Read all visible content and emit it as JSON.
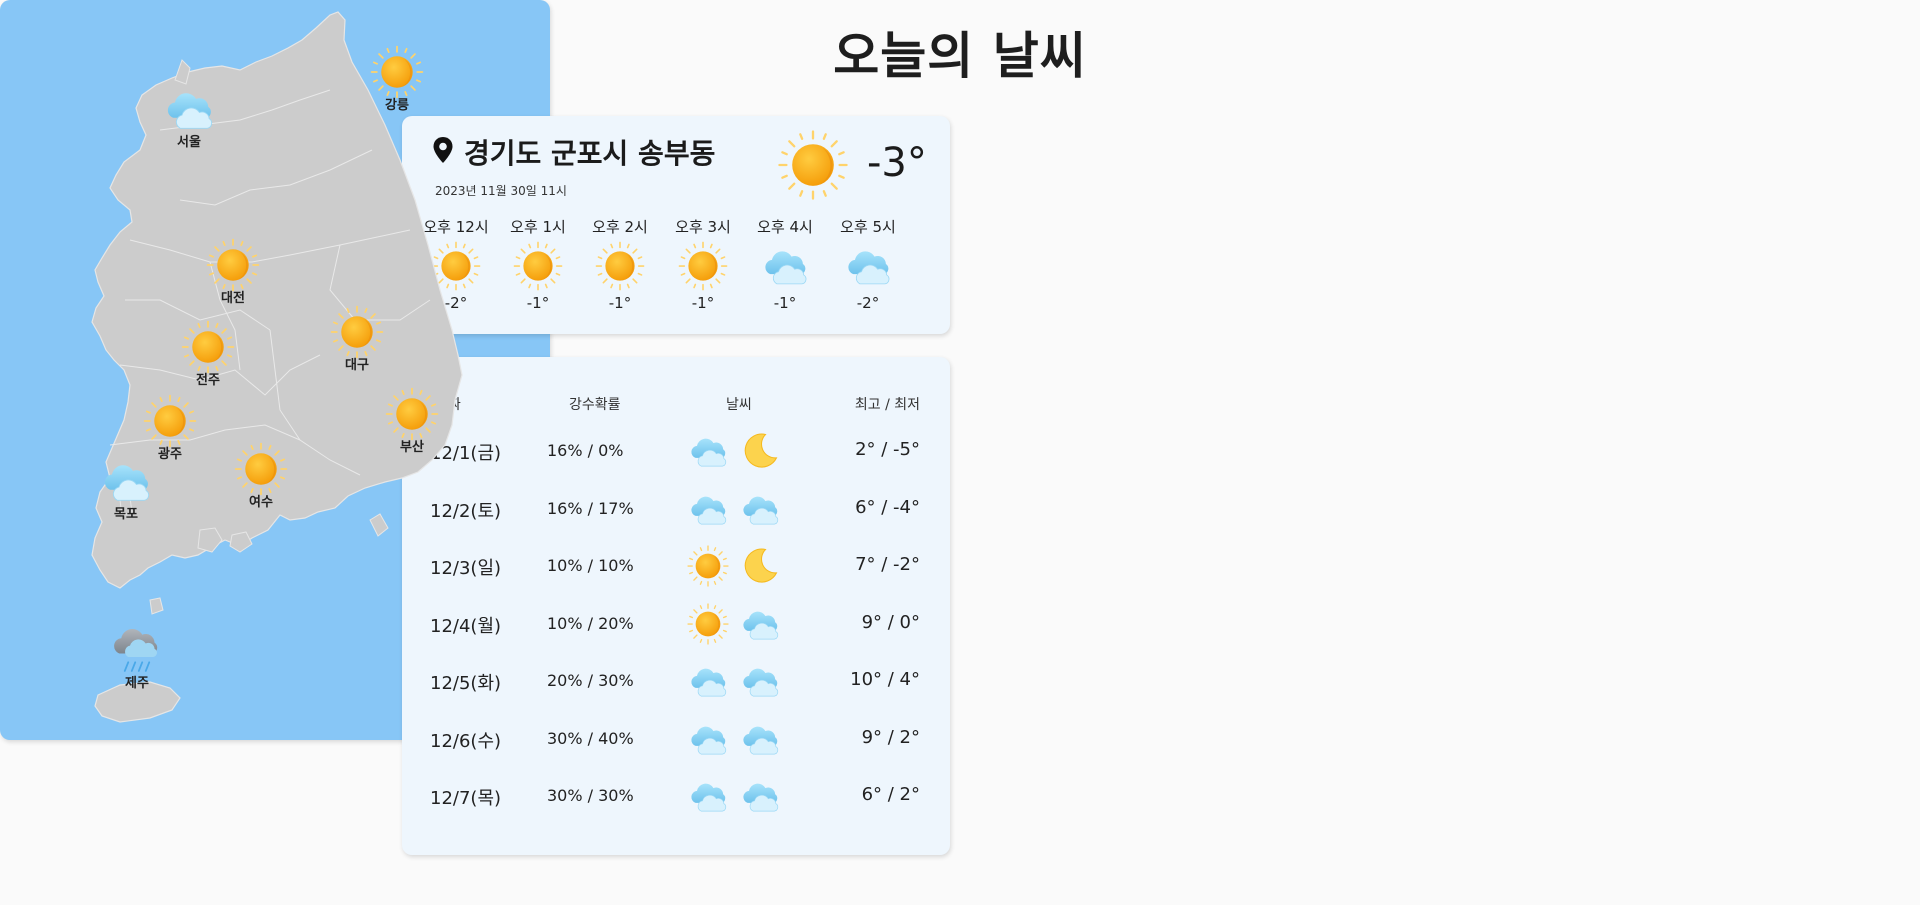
{
  "page": {
    "title": "오늘의 날씨"
  },
  "current": {
    "location": "경기도 군포시 송부동",
    "datetime": "2023년 11월 30일 11시",
    "icon": "sunny-icon",
    "temp": "-3°",
    "hourly": [
      {
        "label": "오후 12시",
        "icon": "sunny",
        "temp": "-2°"
      },
      {
        "label": "오후 1시",
        "icon": "sunny",
        "temp": "-1°"
      },
      {
        "label": "오후 2시",
        "icon": "sunny",
        "temp": "-1°"
      },
      {
        "label": "오후 3시",
        "icon": "sunny",
        "temp": "-1°"
      },
      {
        "label": "오후 4시",
        "icon": "cloudy",
        "temp": "-1°"
      },
      {
        "label": "오후 5시",
        "icon": "cloudy",
        "temp": "-2°"
      }
    ]
  },
  "forecast": {
    "headers": {
      "date": "날짜",
      "rain": "강수확률",
      "weather": "날씨",
      "temp": "최고 / 최저"
    },
    "rows": [
      {
        "date": "12/1(금)",
        "rain": "16% / 0%",
        "am": "cloudy",
        "pm": "moon",
        "temp": "2° / -5°"
      },
      {
        "date": "12/2(토)",
        "rain": "16% / 17%",
        "am": "cloudy",
        "pm": "cloudy",
        "temp": "6° / -4°"
      },
      {
        "date": "12/3(일)",
        "rain": "10% / 10%",
        "am": "sunny",
        "pm": "moon",
        "temp": "7° / -2°"
      },
      {
        "date": "12/4(월)",
        "rain": "10% / 20%",
        "am": "sunny",
        "pm": "cloudy",
        "temp": "9° / 0°"
      },
      {
        "date": "12/5(화)",
        "rain": "20% / 30%",
        "am": "cloudy",
        "pm": "cloudy",
        "temp": "10° / 4°"
      },
      {
        "date": "12/6(수)",
        "rain": "30% / 40%",
        "am": "cloudy",
        "pm": "cloudy",
        "temp": "9° / 2°"
      },
      {
        "date": "12/7(목)",
        "rain": "30% / 30%",
        "am": "cloudy",
        "pm": "cloudy",
        "temp": "6° / 2°"
      }
    ]
  },
  "map": {
    "cities": [
      {
        "name": "서울",
        "icon": "cloudy"
      },
      {
        "name": "강릉",
        "icon": "sunny"
      },
      {
        "name": "대전",
        "icon": "sunny"
      },
      {
        "name": "전주",
        "icon": "sunny"
      },
      {
        "name": "대구",
        "icon": "sunny"
      },
      {
        "name": "광주",
        "icon": "sunny"
      },
      {
        "name": "부산",
        "icon": "sunny"
      },
      {
        "name": "목포",
        "icon": "cloudy"
      },
      {
        "name": "여수",
        "icon": "sunny"
      },
      {
        "name": "제주",
        "icon": "rain"
      }
    ]
  },
  "colors": {
    "sun": "#f9a825",
    "cloud": "#8fd3f4",
    "moon": "#fcd34d",
    "sea": "#87c6f6",
    "land": "#cccccc",
    "card": "#eef6fd"
  }
}
